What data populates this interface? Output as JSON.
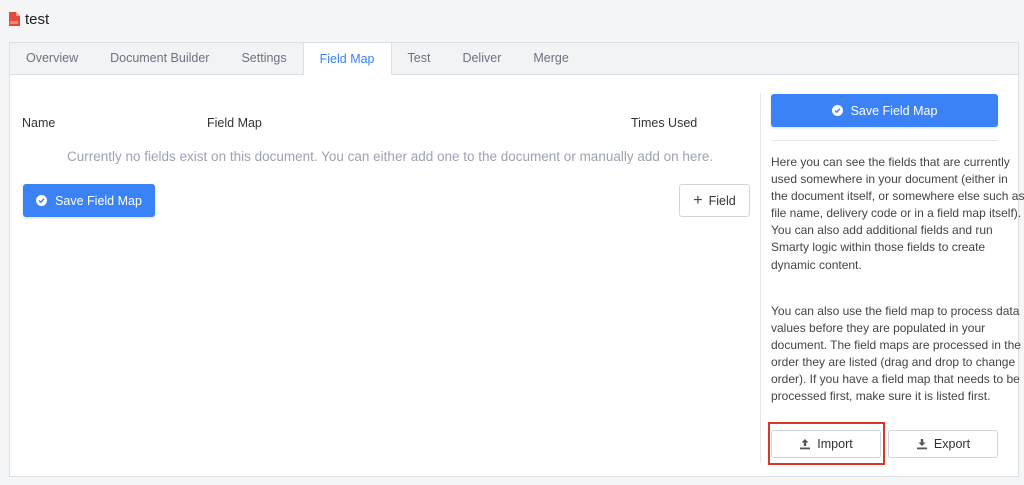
{
  "header": {
    "title": "test",
    "icon": "pdf-file-icon",
    "icon_color": "#e04b3b"
  },
  "tabs": [
    {
      "label": "Overview",
      "active": false
    },
    {
      "label": "Document Builder",
      "active": false
    },
    {
      "label": "Settings",
      "active": false
    },
    {
      "label": "Field Map",
      "active": true
    },
    {
      "label": "Test",
      "active": false
    },
    {
      "label": "Deliver",
      "active": false
    },
    {
      "label": "Merge",
      "active": false
    }
  ],
  "table": {
    "columns": {
      "name": "Name",
      "field_map": "Field Map",
      "times_used": "Times Used"
    },
    "empty_message": "Currently no fields exist on this document. You can either add one to the document or manually add on here."
  },
  "buttons": {
    "save_field_map": "Save Field Map",
    "add_field": "Field",
    "import": "Import",
    "export": "Export"
  },
  "help": {
    "paragraph1": "Here you can see the fields that are currently used somewhere in your document (either in the document itself, or somewhere else such as file name, delivery code or in a field map itself). You can also add additional fields and run Smarty logic within those fields to create dynamic content.",
    "paragraph2": "You can also use the field map to process data values before they are populated in your document. The field maps are processed in the order they are listed (drag and drop to change order). If you have a field map that needs to be processed first, make sure it is listed first."
  },
  "colors": {
    "accent": "#3b82f6",
    "highlight": "#d9372b"
  }
}
